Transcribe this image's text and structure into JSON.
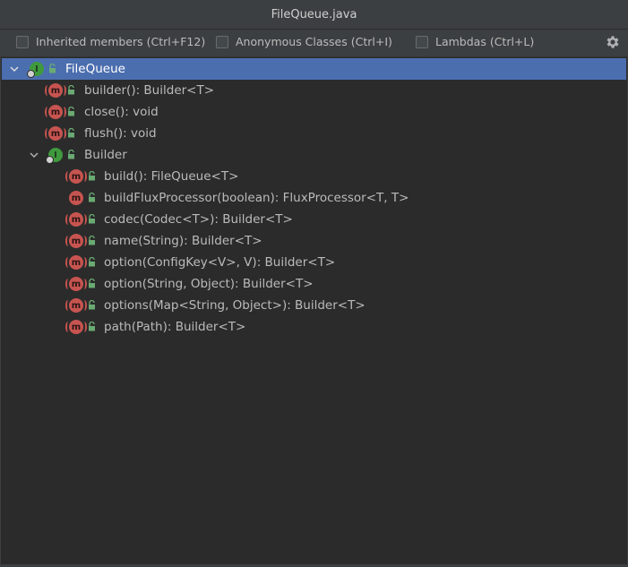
{
  "window": {
    "title": "FileQueue.java"
  },
  "toolbar": {
    "inherited_label": "Inherited members (Ctrl+F12)",
    "anonymous_label": "Anonymous Classes (Ctrl+I)",
    "lambdas_label": "Lambdas (Ctrl+L)",
    "settings_icon": "gear-icon"
  },
  "colors": {
    "selection": "#4b6eaf",
    "class_icon": "#3f9a3e",
    "method_icon": "#c75450",
    "public_lock": "#6aab73"
  },
  "tree": {
    "root": {
      "label": "FileQueue",
      "icon": "class-icon",
      "expanded": true,
      "selected": true
    },
    "root_methods": [
      {
        "label": "builder(): Builder<T>",
        "icon": "static-method-icon"
      },
      {
        "label": "close(): void",
        "icon": "method-icon"
      },
      {
        "label": "flush(): void",
        "icon": "method-icon"
      }
    ],
    "inner": {
      "label": "Builder",
      "icon": "class-icon",
      "expanded": true
    },
    "inner_methods": [
      {
        "label": "build(): FileQueue<T>",
        "icon": "static-method-icon"
      },
      {
        "label": "buildFluxProcessor(boolean): FluxProcessor<T, T>",
        "icon": "method-icon"
      },
      {
        "label": "codec(Codec<T>): Builder<T>",
        "icon": "static-method-icon"
      },
      {
        "label": "name(String): Builder<T>",
        "icon": "static-method-icon"
      },
      {
        "label": "option(ConfigKey<V>, V): Builder<T>",
        "icon": "static-method-icon"
      },
      {
        "label": "option(String, Object): Builder<T>",
        "icon": "static-method-icon"
      },
      {
        "label": "options(Map<String, Object>): Builder<T>",
        "icon": "static-method-icon"
      },
      {
        "label": "path(Path): Builder<T>",
        "icon": "static-method-icon"
      }
    ]
  }
}
